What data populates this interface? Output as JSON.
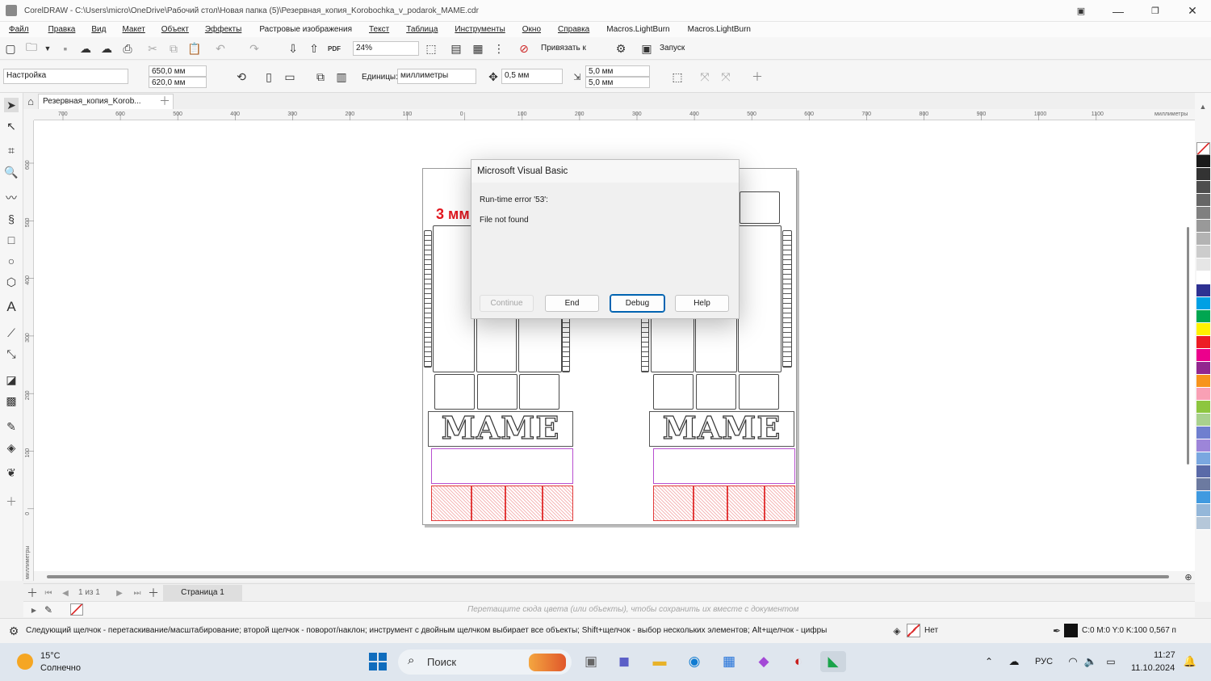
{
  "window": {
    "title": "CorelDRAW - C:\\Users\\micro\\OneDrive\\Рабочий стол\\Новая папка (5)\\Резервная_копия_Korobochka_v_podarok_MAME.cdr"
  },
  "menu": [
    "Файл",
    "Правка",
    "Вид",
    "Макет",
    "Объект",
    "Эффекты",
    "Растровые изображения",
    "Текст",
    "Таблица",
    "Инструменты",
    "Окно",
    "Справка",
    "Macros.LightBurn",
    "Macros.LightBurn"
  ],
  "toolbar": {
    "zoom": "24%",
    "snap_label": "Привязать к",
    "launch_label": "Запуск",
    "pdf_label": "PDF"
  },
  "propbar": {
    "preset": "Настройка",
    "width": "650,0 мм",
    "height": "620,0 мм",
    "units_label": "Единицы:",
    "units_value": "миллиметры",
    "nudge": "0,5 мм",
    "dup_x": "5,0 мм",
    "dup_y": "5,0 мм"
  },
  "doc_tab": "Резервная_копия_Korob...",
  "ruler": {
    "h_labels": [
      "700",
      "600",
      "500",
      "400",
      "300",
      "200",
      "100",
      "0",
      "100",
      "200",
      "300",
      "400",
      "500",
      "600",
      "700",
      "800",
      "900",
      "1000",
      "1100"
    ],
    "h_unit": "миллиметры",
    "v_labels": [
      "600",
      "500",
      "400",
      "300",
      "200",
      "100",
      "0"
    ],
    "v_unit": "миллиметры"
  },
  "canvas": {
    "thickness_label": "3 мм",
    "word": "MAME"
  },
  "dialog": {
    "title": "Microsoft Visual Basic",
    "line1": "Run-time error '53':",
    "line2": "File not found",
    "btn_continue": "Continue",
    "btn_end": "End",
    "btn_debug": "Debug",
    "btn_help": "Help"
  },
  "pagebar": {
    "page_counter": "1 из 1",
    "page_tab": "Страница 1"
  },
  "colorbar": {
    "hint": "Перетащите сюда цвета (или объекты), чтобы сохранить их вместе с документом"
  },
  "status": {
    "hint": "Следующий щелчок - перетаскивание/масштабирование; второй щелчок - поворот/наклон; инструмент с двойным щелчком выбирает все объекты; Shift+щелчок - выбор нескольких элементов; Alt+щелчок - цифры",
    "fill_none": "Нет",
    "outline": "C:0 M:0 Y:0 K:100  0,567 п"
  },
  "taskbar": {
    "temp": "15°C",
    "weather": "Солнечно",
    "search": "Поиск",
    "lang": "РУС",
    "time": "11:27",
    "date": "11.10.2024"
  },
  "palette": [
    "#ffffff",
    "#1a1a1a",
    "#333333",
    "#4d4d4d",
    "#666666",
    "#808080",
    "#999999",
    "#b3b3b3",
    "#cccccc",
    "#e6e6e6",
    "#ffffff",
    "#2e3192",
    "#00a0e4",
    "#00a651",
    "#fff200",
    "#ed1c24",
    "#ec008c",
    "#92278f",
    "#f7941d",
    "#f9a0b5",
    "#8dc63f",
    "#a9d18e",
    "#6f7fcf",
    "#9d85d9",
    "#7aa7e0",
    "#5a6aa8",
    "#6c7aa0",
    "#3f9ae0",
    "#94b7d9",
    "#b5c7d9"
  ]
}
